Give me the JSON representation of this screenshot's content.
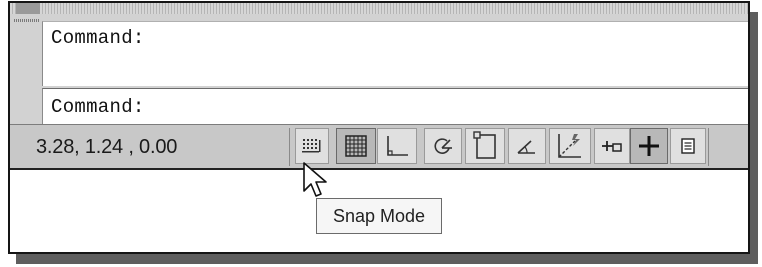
{
  "command_window": {
    "history_text": "Command:",
    "prompt_text": "Command:"
  },
  "status_bar": {
    "coordinates": "3.28, 1.24 , 0.00",
    "buttons": [
      {
        "name": "snap-mode-button",
        "icon": "snap-icon",
        "state": "off"
      },
      {
        "name": "grid-display-button",
        "icon": "grid-icon",
        "state": "on"
      },
      {
        "name": "ortho-mode-button",
        "icon": "ortho-icon",
        "state": "off"
      },
      {
        "name": "polar-tracking-button",
        "icon": "polar-icon",
        "state": "off"
      },
      {
        "name": "object-snap-button",
        "icon": "osnap-icon",
        "state": "off"
      },
      {
        "name": "object-snap-tracking-button",
        "icon": "otrack-icon",
        "state": "off"
      },
      {
        "name": "dynamic-ucs-button",
        "icon": "ducs-icon",
        "state": "off"
      },
      {
        "name": "dynamic-input-button",
        "icon": "dyn-icon",
        "state": "off"
      },
      {
        "name": "lineweight-button",
        "icon": "lineweight-icon",
        "state": "on"
      },
      {
        "name": "quick-properties-button",
        "icon": "qp-icon",
        "state": "off"
      }
    ]
  },
  "tooltip": {
    "text": "Snap Mode"
  }
}
